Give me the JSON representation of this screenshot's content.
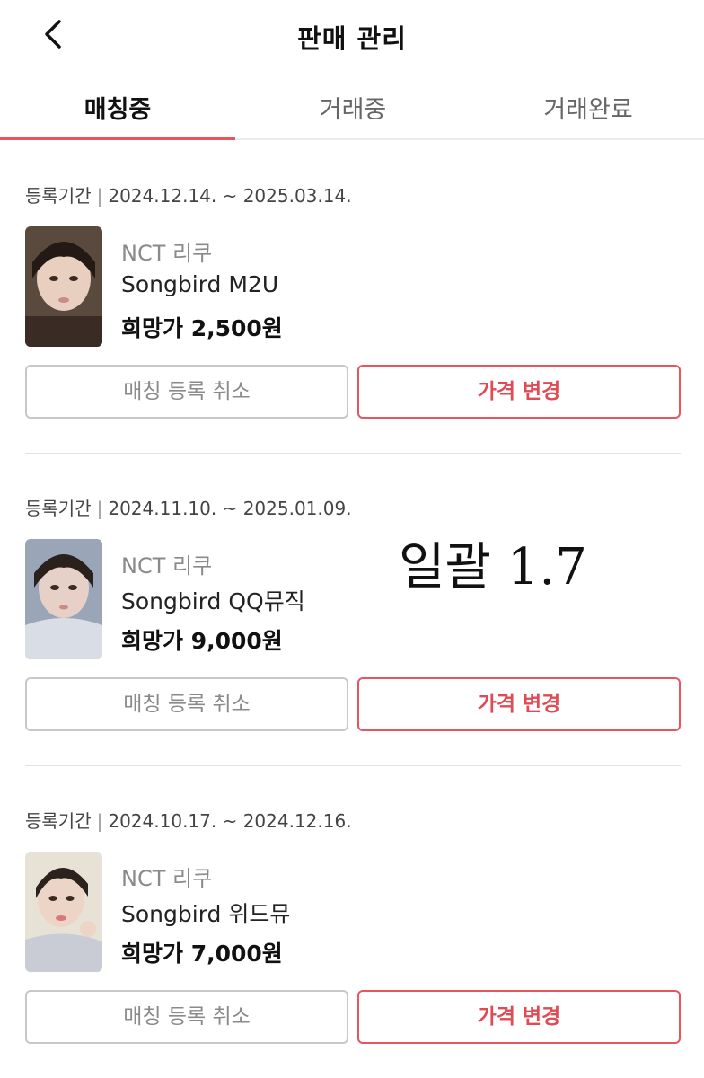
{
  "header": {
    "title": "판매 관리"
  },
  "tabs": [
    {
      "label": "매칭중",
      "active": true
    },
    {
      "label": "거래중",
      "active": false
    },
    {
      "label": "거래완료",
      "active": false
    }
  ],
  "accent_color": "#e8555e",
  "items": [
    {
      "period_label": "등록기간",
      "period": "2024.12.14. ~ 2025.03.14.",
      "artist": "NCT 리쿠",
      "album": "Songbird M2U",
      "price": "희망가 2,500원",
      "cancel_label": "매칭 등록 취소",
      "change_label": "가격 변경"
    },
    {
      "period_label": "등록기간",
      "period": "2024.11.10. ~ 2025.01.09.",
      "artist": "NCT 리쿠",
      "album": "Songbird QQ뮤직",
      "price": "희망가 9,000원",
      "cancel_label": "매칭 등록 취소",
      "change_label": "가격 변경"
    },
    {
      "period_label": "등록기간",
      "period": "2024.10.17. ~ 2024.12.16.",
      "artist": "NCT 리쿠",
      "album": "Songbird 위드뮤",
      "price": "희망가 7,000원",
      "cancel_label": "매칭 등록 취소",
      "change_label": "가격 변경"
    }
  ],
  "handwritten_note": "일괄 1.7"
}
